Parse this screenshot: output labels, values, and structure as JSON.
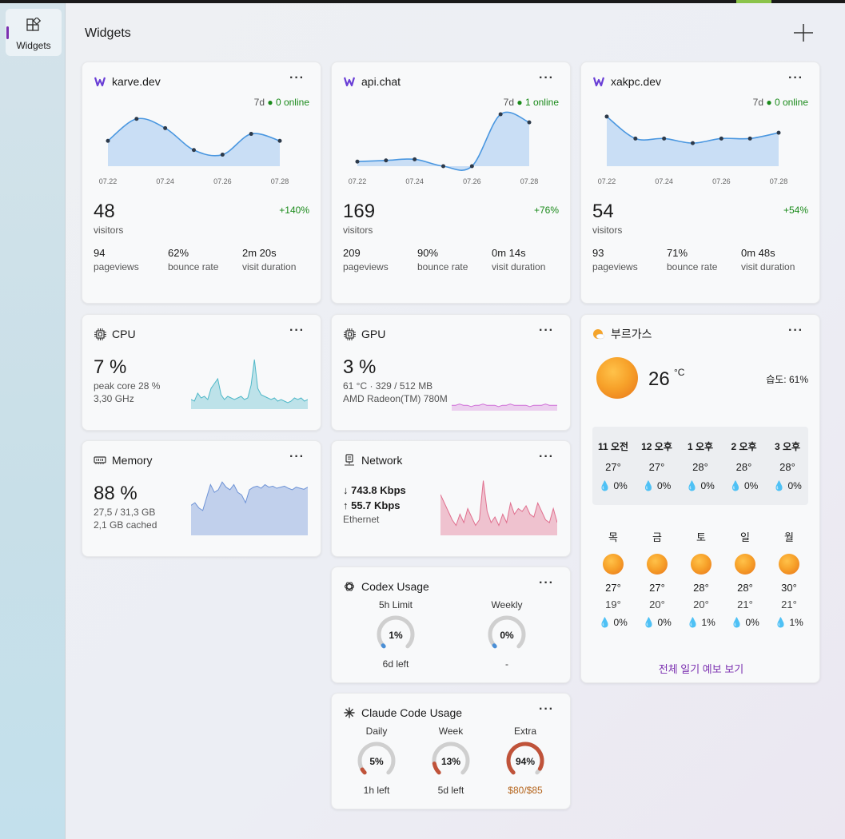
{
  "header": {
    "title": "Widgets"
  },
  "sidebar": {
    "label": "Widgets"
  },
  "sites": [
    {
      "name": "karve.dev",
      "period": "7d",
      "online": "0 online",
      "visitors": "48",
      "visitors_label": "visitors",
      "change": "+140%",
      "pageviews": "94",
      "pageviews_label": "pageviews",
      "bounce": "62%",
      "bounce_label": "bounce rate",
      "duration": "2m 20s",
      "duration_label": "visit duration",
      "x_ticks": [
        "07.22",
        "07.24",
        "07.26",
        "07.28"
      ],
      "series": [
        22,
        41,
        33,
        14,
        10,
        28,
        22
      ]
    },
    {
      "name": "api.chat",
      "period": "7d",
      "online": "1 online",
      "visitors": "169",
      "visitors_label": "visitors",
      "change": "+76%",
      "pageviews": "209",
      "pageviews_label": "pageviews",
      "bounce": "90%",
      "bounce_label": "bounce rate",
      "duration": "0m 14s",
      "duration_label": "visit duration",
      "x_ticks": [
        "07.22",
        "07.24",
        "07.26",
        "07.28"
      ],
      "series": [
        4,
        5,
        6,
        0,
        0,
        45,
        38
      ]
    },
    {
      "name": "xakpc.dev",
      "period": "7d",
      "online": "0 online",
      "visitors": "54",
      "visitors_label": "visitors",
      "change": "+54%",
      "pageviews": "93",
      "pageviews_label": "pageviews",
      "bounce": "71%",
      "bounce_label": "bounce rate",
      "duration": "0m 48s",
      "duration_label": "visit duration",
      "x_ticks": [
        "07.22",
        "07.24",
        "07.26",
        "07.28"
      ],
      "series": [
        43,
        24,
        24,
        20,
        24,
        24,
        29
      ]
    }
  ],
  "cpu": {
    "title": "CPU",
    "value": "7 %",
    "line1": "peak core 28 %",
    "line2": "3,30 GHz",
    "color": "#4fb8c8",
    "history": [
      5,
      4,
      9,
      6,
      7,
      5,
      12,
      15,
      18,
      8,
      5,
      7,
      6,
      5,
      6,
      7,
      5,
      6,
      14,
      30,
      12,
      8,
      7,
      6,
      5,
      6,
      4,
      5,
      4,
      3,
      4,
      6,
      5,
      6,
      4,
      5
    ]
  },
  "gpu": {
    "title": "GPU",
    "value": "3 %",
    "line1": "61 °C · 329 / 512 MB",
    "line2": "AMD Radeon(TM) 780M",
    "color": "#d070d8",
    "history": [
      3,
      3,
      4,
      3,
      3,
      2,
      3,
      3,
      4,
      3,
      3,
      3,
      2,
      3,
      3,
      4,
      3,
      3,
      3,
      3,
      2,
      3,
      3,
      3,
      4,
      3,
      3,
      3
    ]
  },
  "memory": {
    "title": "Memory",
    "value": "88 %",
    "line1": "27,5 / 31,3 GB",
    "line2": "2,1 GB cached",
    "color": "#6e93d6",
    "history": [
      55,
      60,
      50,
      45,
      70,
      95,
      80,
      85,
      100,
      90,
      85,
      95,
      80,
      75,
      60,
      85,
      90,
      92,
      88,
      95,
      90,
      92,
      88,
      90,
      92,
      88,
      85,
      90,
      88,
      86,
      90
    ]
  },
  "network": {
    "title": "Network",
    "down": "↓ 743.8 Kbps",
    "up": "↑ 55.7 Kbps",
    "line": "Ethernet",
    "color": "#e0708f",
    "history": [
      70,
      55,
      40,
      25,
      15,
      35,
      20,
      45,
      30,
      15,
      25,
      95,
      40,
      20,
      30,
      15,
      35,
      20,
      55,
      35,
      45,
      40,
      50,
      35,
      30,
      55,
      40,
      25,
      20,
      45,
      20
    ]
  },
  "weather": {
    "city": "부르가스",
    "temp": "26",
    "unit": "°C",
    "humidity": "습도: 61%",
    "hourly": [
      {
        "time": "11 오전",
        "temp": "27°",
        "rain": "0%"
      },
      {
        "time": "12 오후",
        "temp": "27°",
        "rain": "0%"
      },
      {
        "time": "1 오후",
        "temp": "28°",
        "rain": "0%"
      },
      {
        "time": "2 오후",
        "temp": "28°",
        "rain": "0%"
      },
      {
        "time": "3 오후",
        "temp": "28°",
        "rain": "0%"
      }
    ],
    "daily": [
      {
        "day": "목",
        "hi": "27°",
        "lo": "19°",
        "rain": "0%"
      },
      {
        "day": "금",
        "hi": "27°",
        "lo": "20°",
        "rain": "0%"
      },
      {
        "day": "토",
        "hi": "28°",
        "lo": "20°",
        "rain": "1%"
      },
      {
        "day": "일",
        "hi": "28°",
        "lo": "21°",
        "rain": "0%"
      },
      {
        "day": "월",
        "hi": "30°",
        "lo": "21°",
        "rain": "1%"
      }
    ],
    "link": "전체 일기 예보 보기"
  },
  "codex": {
    "title": "Codex Usage",
    "gauges": [
      {
        "label": "5h Limit",
        "percent_text": "1%",
        "percent": 1,
        "bottom": "6d left",
        "color": "#4a8fd6"
      },
      {
        "label": "Weekly",
        "percent_text": "0%",
        "percent": 0,
        "bottom": "-",
        "color": "#4a8fd6"
      }
    ]
  },
  "claude": {
    "title": "Claude Code Usage",
    "gauges": [
      {
        "label": "Daily",
        "percent_text": "5%",
        "percent": 5,
        "bottom": "1h left",
        "color": "#c0533a"
      },
      {
        "label": "Week",
        "percent_text": "13%",
        "percent": 13,
        "bottom": "5d left",
        "color": "#c0533a"
      },
      {
        "label": "Extra",
        "percent_text": "94%",
        "percent": 94,
        "bottom": "$80/$85",
        "color": "#c0533a",
        "bottom_color": "#b5651d"
      }
    ]
  }
}
